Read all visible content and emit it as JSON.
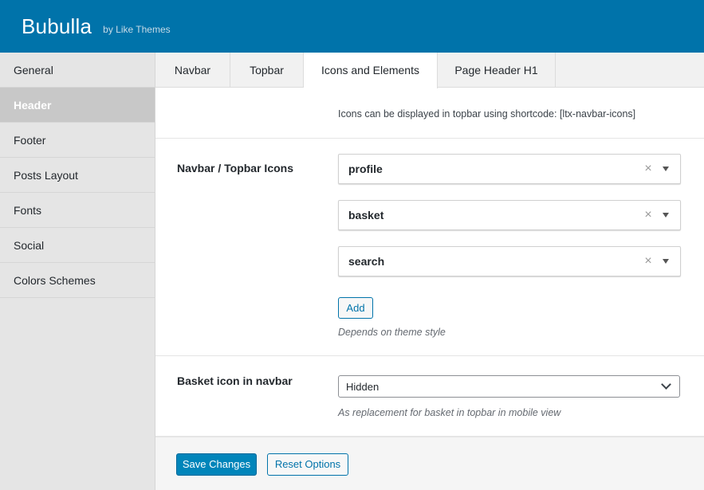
{
  "header": {
    "brand": "Bubulla",
    "byline": "by Like Themes"
  },
  "sidebar": {
    "items": [
      {
        "label": "General"
      },
      {
        "label": "Header"
      },
      {
        "label": "Footer"
      },
      {
        "label": "Posts Layout"
      },
      {
        "label": "Fonts"
      },
      {
        "label": "Social"
      },
      {
        "label": "Colors Schemes"
      }
    ],
    "active_index": 1
  },
  "tabs": {
    "items": [
      {
        "label": "Navbar"
      },
      {
        "label": "Topbar"
      },
      {
        "label": "Icons and Elements"
      },
      {
        "label": "Page Header H1"
      }
    ],
    "active_index": 2
  },
  "info": {
    "text": "Icons can be displayed in topbar using shortcode: [ltx-navbar-icons]"
  },
  "icons_field": {
    "label": "Navbar / Topbar Icons",
    "selects": [
      {
        "value": "profile"
      },
      {
        "value": "basket"
      },
      {
        "value": "search"
      }
    ],
    "clear_glyph": "×",
    "add_label": "Add",
    "hint": "Depends on theme style"
  },
  "basket_field": {
    "label": "Basket icon in navbar",
    "value": "Hidden",
    "hint": "As replacement for basket in topbar in mobile view"
  },
  "footer": {
    "save_label": "Save Changes",
    "reset_label": "Reset Options"
  },
  "colors": {
    "header_bg": "#0073aa",
    "primary_button": "#0085ba",
    "sidebar_active": "#c8c8c8"
  }
}
